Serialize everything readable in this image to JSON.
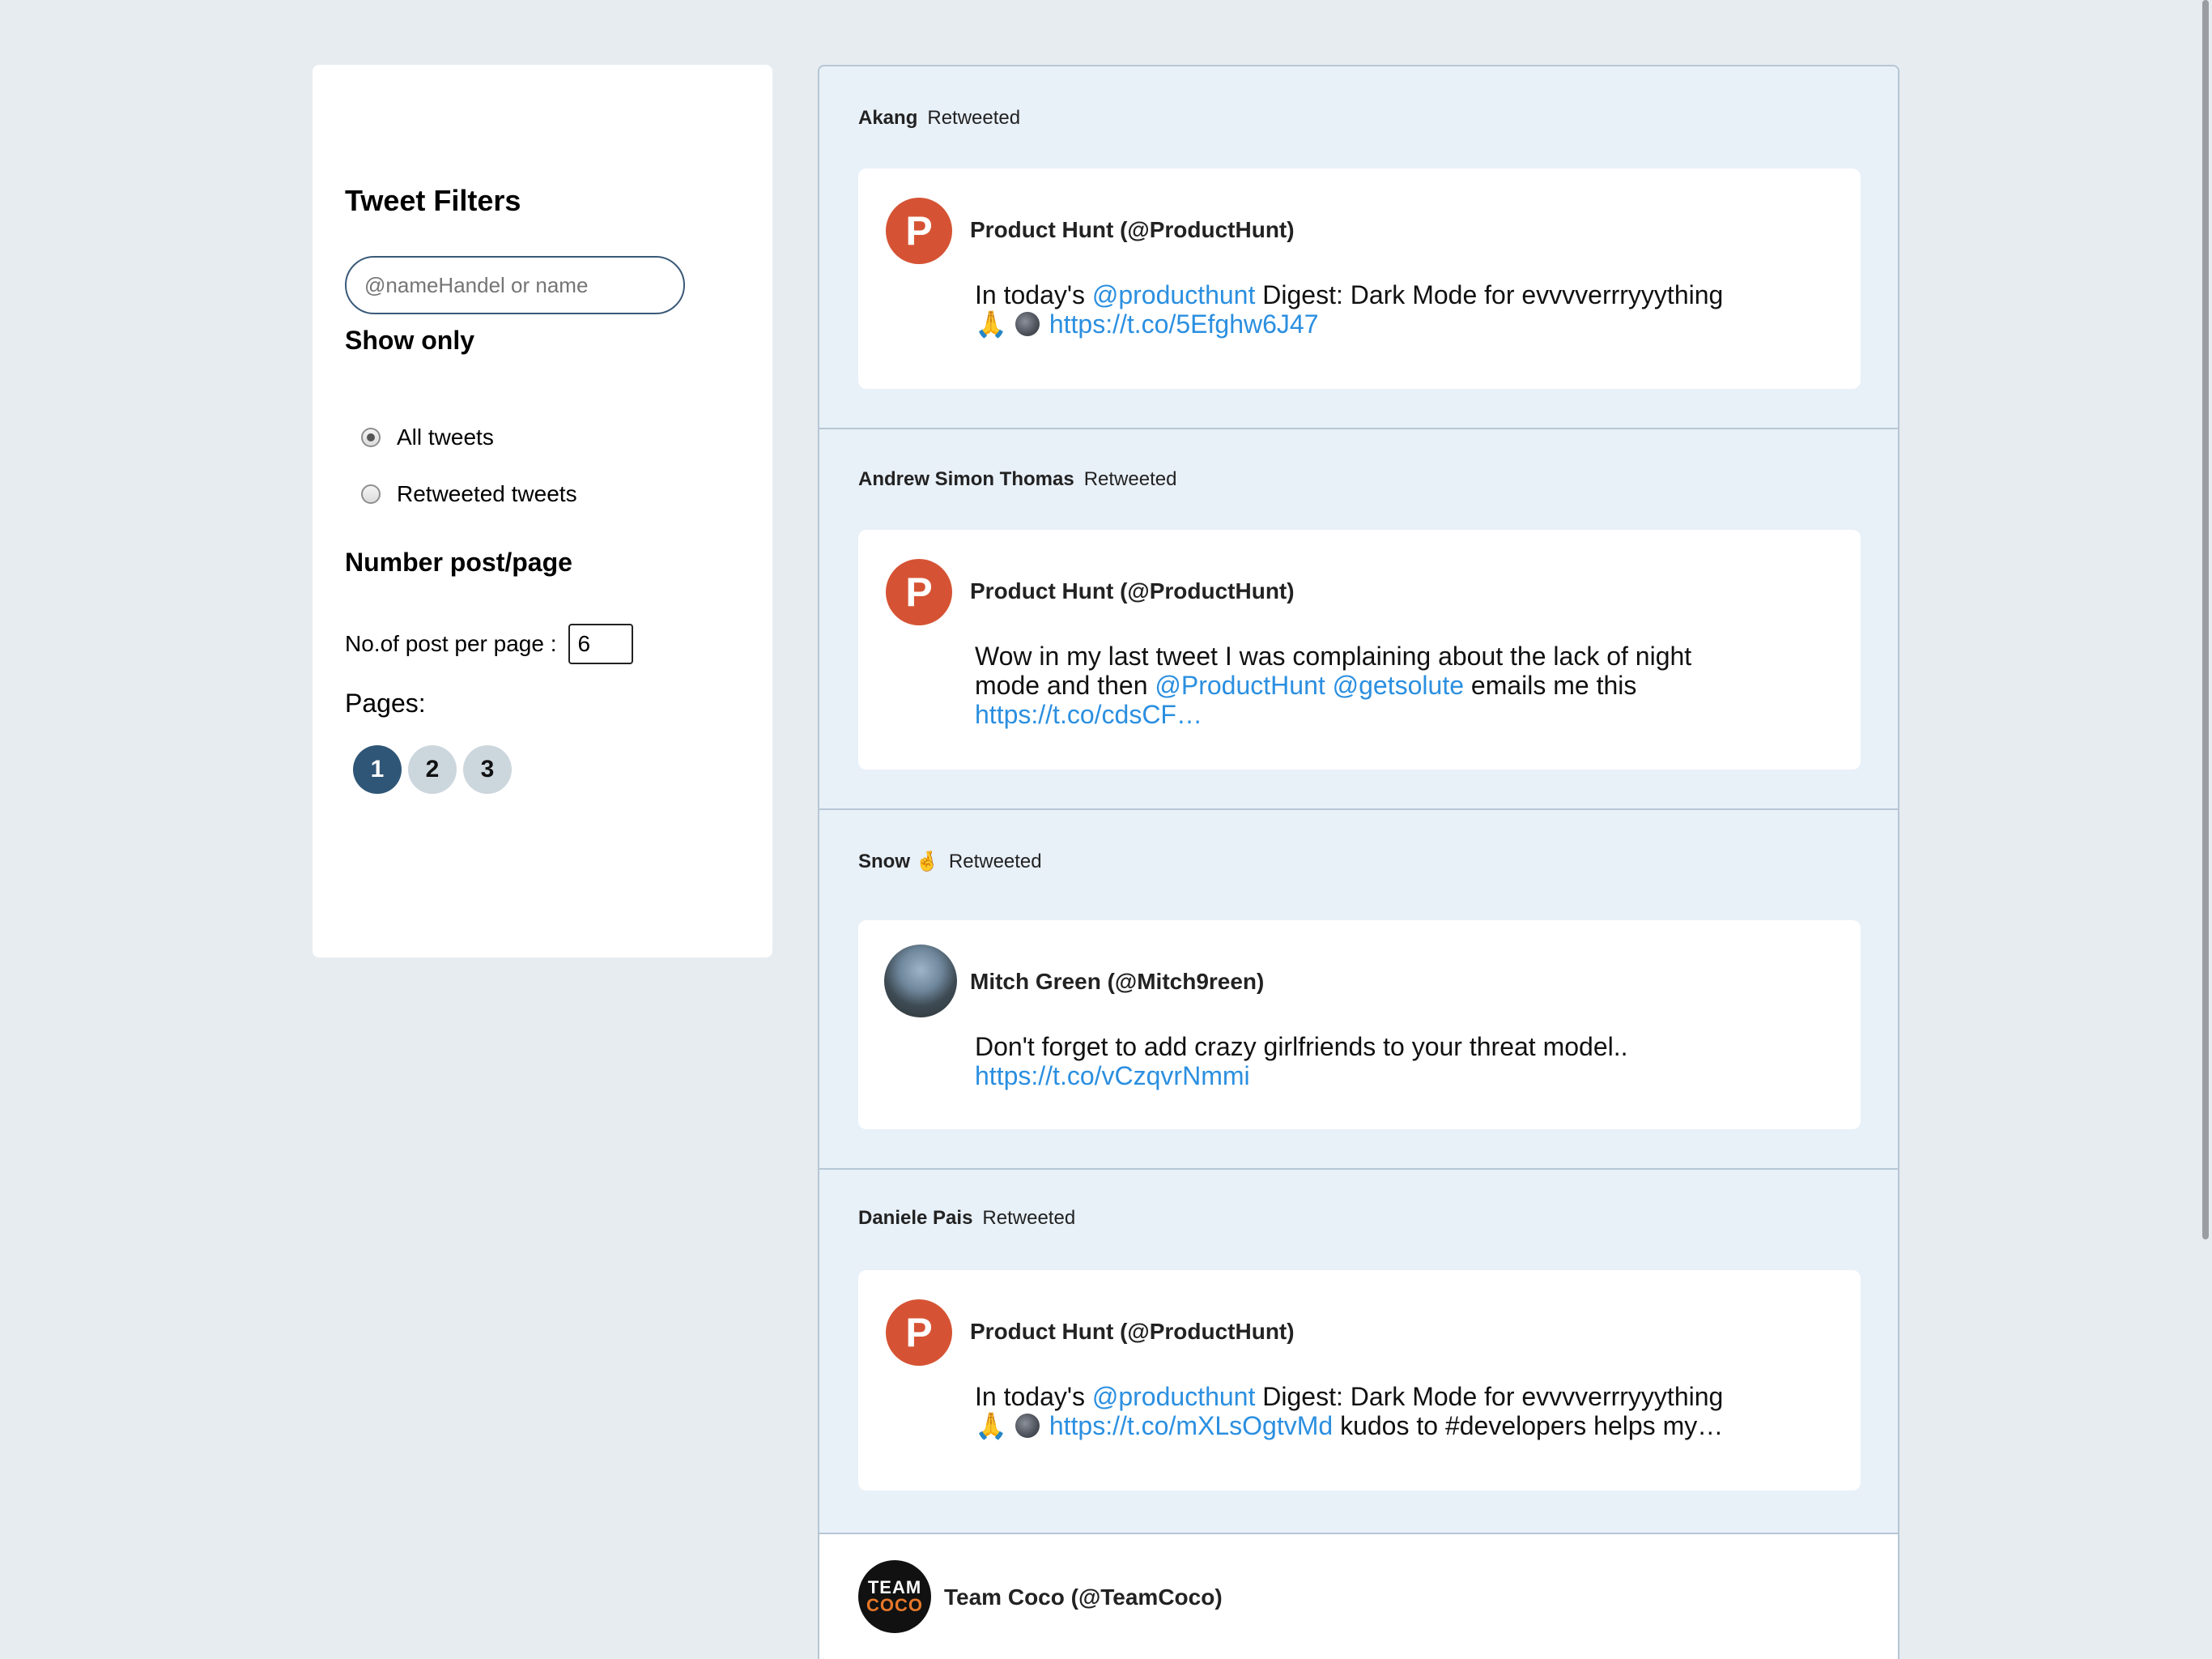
{
  "filters": {
    "title": "Tweet Filters",
    "search_placeholder": "@nameHandel or name",
    "show_only_title": "Show only",
    "options": [
      "All tweets",
      "Retweeted tweets"
    ],
    "selected_option": "All tweets",
    "number_title": "Number post/page",
    "per_page_label": "No.of post per page :",
    "per_page_value": "6",
    "pages_label": "Pages:",
    "pages": [
      "1",
      "2",
      "3"
    ],
    "active_page": "1"
  },
  "feed": {
    "retweets": [
      {
        "retweeter": "Akang",
        "retweeter_emoji": "",
        "label": "Retweeted",
        "author": "Product Hunt (@ProductHunt)",
        "avatar": "product-hunt-logo",
        "text_pre": "In today's ",
        "mention1": "@producthunt",
        "text_mid": " Digest: Dark Mode for evvvverrryyything",
        "emoji1": "🙏",
        "link": "https://t.co/5Efghw6J47",
        "text_post": ""
      },
      {
        "retweeter": "Andrew Simon Thomas",
        "retweeter_emoji": "",
        "label": "Retweeted",
        "author": "Product Hunt (@ProductHunt)",
        "avatar": "product-hunt-logo",
        "text_pre": "Wow in my last tweet I was complaining about the lack of night mode and then ",
        "mention1": "@ProductHunt",
        "mention2": "@getsolute",
        "text_mid": " emails me this",
        "link": "https://t.co/cdsCF…"
      },
      {
        "retweeter": "Snow",
        "retweeter_emoji": "🤞",
        "label": "Retweeted",
        "author": "Mitch Green (@Mitch9reen)",
        "avatar": "user-photo",
        "text_pre": "Don't forget to add crazy girlfriends to your threat model..",
        "link": "https://t.co/vCzqvrNmmi"
      },
      {
        "retweeter": "Daniele Pais",
        "retweeter_emoji": "",
        "label": "Retweeted",
        "author": "Product Hunt (@ProductHunt)",
        "avatar": "product-hunt-logo",
        "text_pre": "In today's ",
        "mention1": "@producthunt",
        "text_mid": " Digest: Dark Mode for evvvverrryyything",
        "emoji1": "🙏",
        "link": "https://t.co/mXLsOgtvMd",
        "text_post": " kudos to #developers helps my…"
      }
    ],
    "plain_tweet": {
      "author": "Team Coco (@TeamCoco)",
      "avatar_line1": "TEAM",
      "avatar_line2": "COCO"
    },
    "ph_letter": "P"
  },
  "colors": {
    "background": "#e6ecf0",
    "link": "#2b8fe0",
    "active_page": "#2f5677",
    "product_hunt": "#d55334"
  }
}
